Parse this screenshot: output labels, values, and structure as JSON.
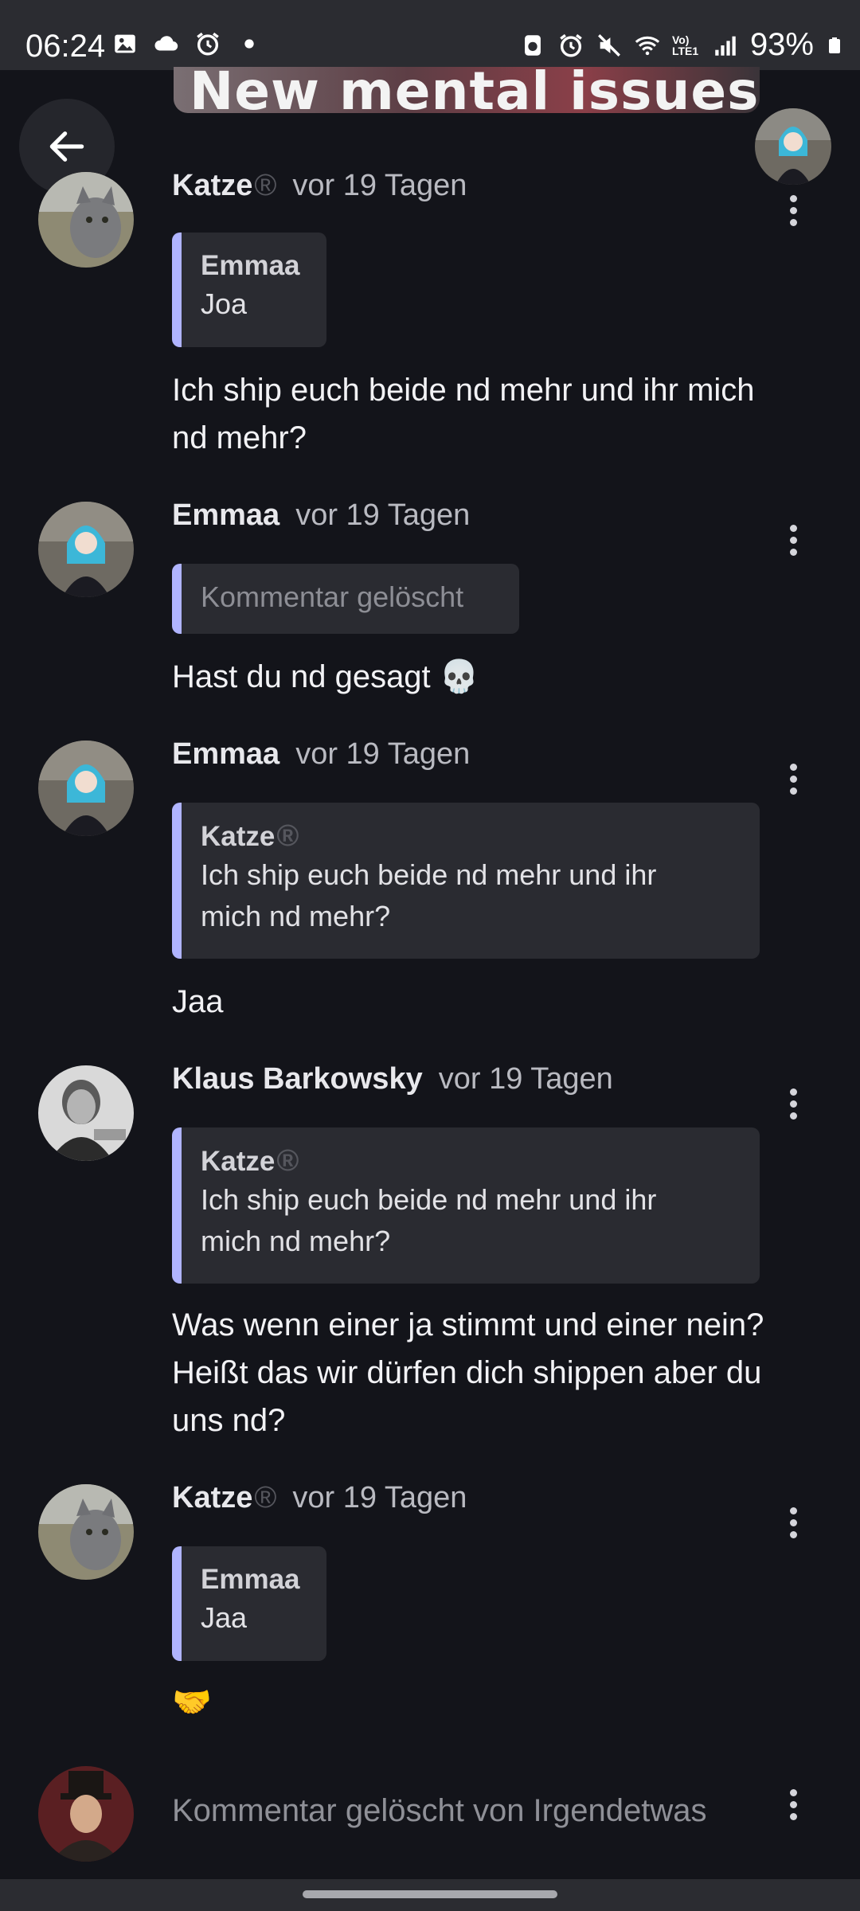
{
  "status_bar": {
    "time": "06:24",
    "battery": "93%",
    "network_label": "Vo) LTE1",
    "icons": [
      "gallery-icon",
      "cloud-icon",
      "alarm-icon",
      "dot-icon",
      "recycle-icon",
      "alarm-icon",
      "mute-icon",
      "wifi-icon",
      "signal-icon",
      "battery-icon"
    ]
  },
  "banner": {
    "text": "New mental issues"
  },
  "back_icon": "arrow-left-icon",
  "comments": [
    {
      "author": "Katze",
      "registered_badge": "®",
      "time": "vor 19 Tagen",
      "quote": {
        "author": "Emmaa",
        "text": "Joa"
      },
      "text": "Ich ship euch beide nd mehr und ihr mich nd mehr?"
    },
    {
      "author": "Emmaa",
      "time": "vor 19 Tagen",
      "quote": {
        "text": "Kommentar gelöscht"
      },
      "text": "Hast du nd gesagt 💀"
    },
    {
      "author": "Emmaa",
      "time": "vor 19 Tagen",
      "quote": {
        "author": "Katze",
        "registered_badge": "®",
        "text": "Ich ship euch beide nd mehr und ihr mich nd mehr?"
      },
      "text": "Jaa"
    },
    {
      "author": "Klaus Barkowsky",
      "time": "vor 19 Tagen",
      "quote": {
        "author": "Katze",
        "registered_badge": "®",
        "text": "Ich ship euch beide nd mehr und ihr mich nd mehr?"
      },
      "text": "Was wenn einer ja stimmt und einer nein? Heißt das wir dürfen dich shippen aber du uns nd?"
    },
    {
      "author": "Katze",
      "registered_badge": "®",
      "time": "vor 19 Tagen",
      "quote": {
        "author": "Emmaa",
        "text": "Jaa"
      },
      "text": "🤝"
    },
    {
      "text": "Kommentar gelöscht von Irgendetwas"
    }
  ],
  "colors": {
    "background": "#13141a",
    "quote_bar": "#b0b4ff",
    "quote_bg": "#2a2b31",
    "status_bar": "#2b2c31"
  }
}
